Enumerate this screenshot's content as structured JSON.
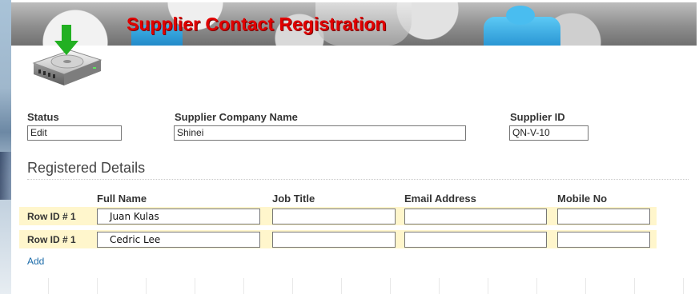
{
  "banner": {
    "title": "Supplier Contact Registration"
  },
  "form": {
    "status": {
      "label": "Status",
      "value": "Edit"
    },
    "company": {
      "label": "Supplier Company Name",
      "value": "Shinei"
    },
    "supplier_id": {
      "label": "Supplier ID",
      "value": "QN-V-10"
    }
  },
  "registered": {
    "heading": "Registered Details",
    "columns": [
      "Full Name",
      "Job Title",
      "Email Address",
      "Mobile No"
    ],
    "rows": [
      {
        "row_id": "Row ID # 1",
        "full_name": "Juan Kulas",
        "job_title": "",
        "email": "",
        "mobile": ""
      },
      {
        "row_id": "Row ID # 1",
        "full_name": "Cedric Lee",
        "job_title": "",
        "email": "",
        "mobile": ""
      }
    ],
    "add_label": "Add"
  },
  "colors": {
    "title_red": "#e10000",
    "row_band": "#fff6cc",
    "link_blue": "#1a6aa8"
  },
  "icons": {
    "drive": "hard-drive-download-icon"
  }
}
